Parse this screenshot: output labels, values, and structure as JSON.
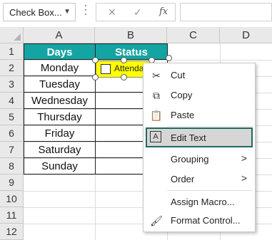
{
  "formula_bar": {
    "name_box": "Check Box...",
    "cancel_icon": "x-icon",
    "enter_icon": "check-icon",
    "fx_label": "fx",
    "formula_value": ""
  },
  "columns": [
    "A",
    "B",
    "C",
    "D"
  ],
  "rows": [
    "1",
    "2",
    "3",
    "4",
    "5",
    "6",
    "7",
    "8",
    "9",
    "10",
    "11",
    "12"
  ],
  "table": {
    "header_days": "Days",
    "header_status": "Status",
    "days": [
      "Monday",
      "Tuesday",
      "Wednesday",
      "Thursday",
      "Friday",
      "Saturday",
      "Sunday"
    ]
  },
  "checkbox": {
    "label": "Attenda",
    "checked": false,
    "fill_color": "#ffff00"
  },
  "context_menu": {
    "items": [
      {
        "label": "Cut",
        "icon": "scissors-icon"
      },
      {
        "label": "Copy",
        "icon": "copy-icon"
      },
      {
        "label": "Paste",
        "icon": "paste-icon"
      },
      {
        "label": "Edit Text",
        "icon": "edit-text-icon",
        "highlighted": true
      },
      {
        "label": "Grouping",
        "submenu": true
      },
      {
        "label": "Order",
        "submenu": true
      },
      {
        "label": "Assign Macro...",
        "icon": null
      },
      {
        "label": "Format Control...",
        "icon": "format-control-icon"
      }
    ],
    "submenu_glyph": ">"
  },
  "colors": {
    "header_fill": "#15a4a4",
    "header_text": "#ffffff",
    "highlight_border": "#1d6a5f",
    "highlight_fill": "#d6d6d6"
  }
}
